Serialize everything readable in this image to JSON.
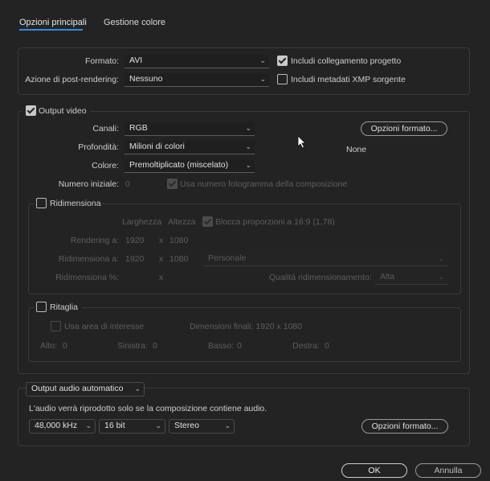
{
  "tabs": {
    "main": "Opzioni principali",
    "color": "Gestione colore"
  },
  "top": {
    "formato_label": "Formato:",
    "formato_value": "AVI",
    "post_label": "Azione di post-rendering:",
    "post_value": "Nessuno",
    "include_project_link": "Includi collegamento progetto",
    "include_xmp": "Includi metadati XMP sorgente"
  },
  "video": {
    "title": "Output video",
    "canali_label": "Canali:",
    "canali_value": "RGB",
    "profondita_label": "Profondità:",
    "profondita_value": "Milioni di colori",
    "colore_label": "Colore:",
    "colore_value": "Premoltiplicato (miscelato)",
    "numero_label": "Numero iniziale:",
    "numero_value": "0",
    "use_frame_number": "Usa numero fotogramma della composizione",
    "format_options_button": "Opzioni formato...",
    "codec_none": "None"
  },
  "resize": {
    "title": "Ridimensiona",
    "width_header": "Larghezza",
    "height_header": "Altezza",
    "lock_ratio": "Blocca proporzioni a 16:9 (1,78)",
    "render_label": "Rendering a:",
    "render_w": "1920",
    "render_x": "x",
    "render_h": "1080",
    "resize_label": "Ridimensiona a:",
    "resize_w": "1920",
    "resize_x": "x",
    "resize_h": "1080",
    "preset_value": "Personale",
    "percent_label": "Ridimensiona %:",
    "percent_x": "x",
    "quality_label": "Qualità ridimensionamento:",
    "quality_value": "Alta"
  },
  "crop": {
    "title": "Ritaglia",
    "use_roi": "Usa area di interesse",
    "final_dims": "Dimensioni finali: 1920 x 1080",
    "top_label": "Alto:",
    "top_value": "0",
    "left_label": "Sinistra:",
    "left_value": "0",
    "bottom_label": "Basso:",
    "bottom_value": "0",
    "right_label": "Destra:",
    "right_value": "0"
  },
  "audio": {
    "mode_value": "Output audio automatico",
    "note": "L'audio verrà riprodotto solo se la composizione contiene audio.",
    "rate_value": "48,000 kHz",
    "bits_value": "16 bit",
    "channels_value": "Stereo",
    "format_options_button": "Opzioni formato..."
  },
  "footer": {
    "ok": "OK",
    "cancel": "Annulla"
  }
}
